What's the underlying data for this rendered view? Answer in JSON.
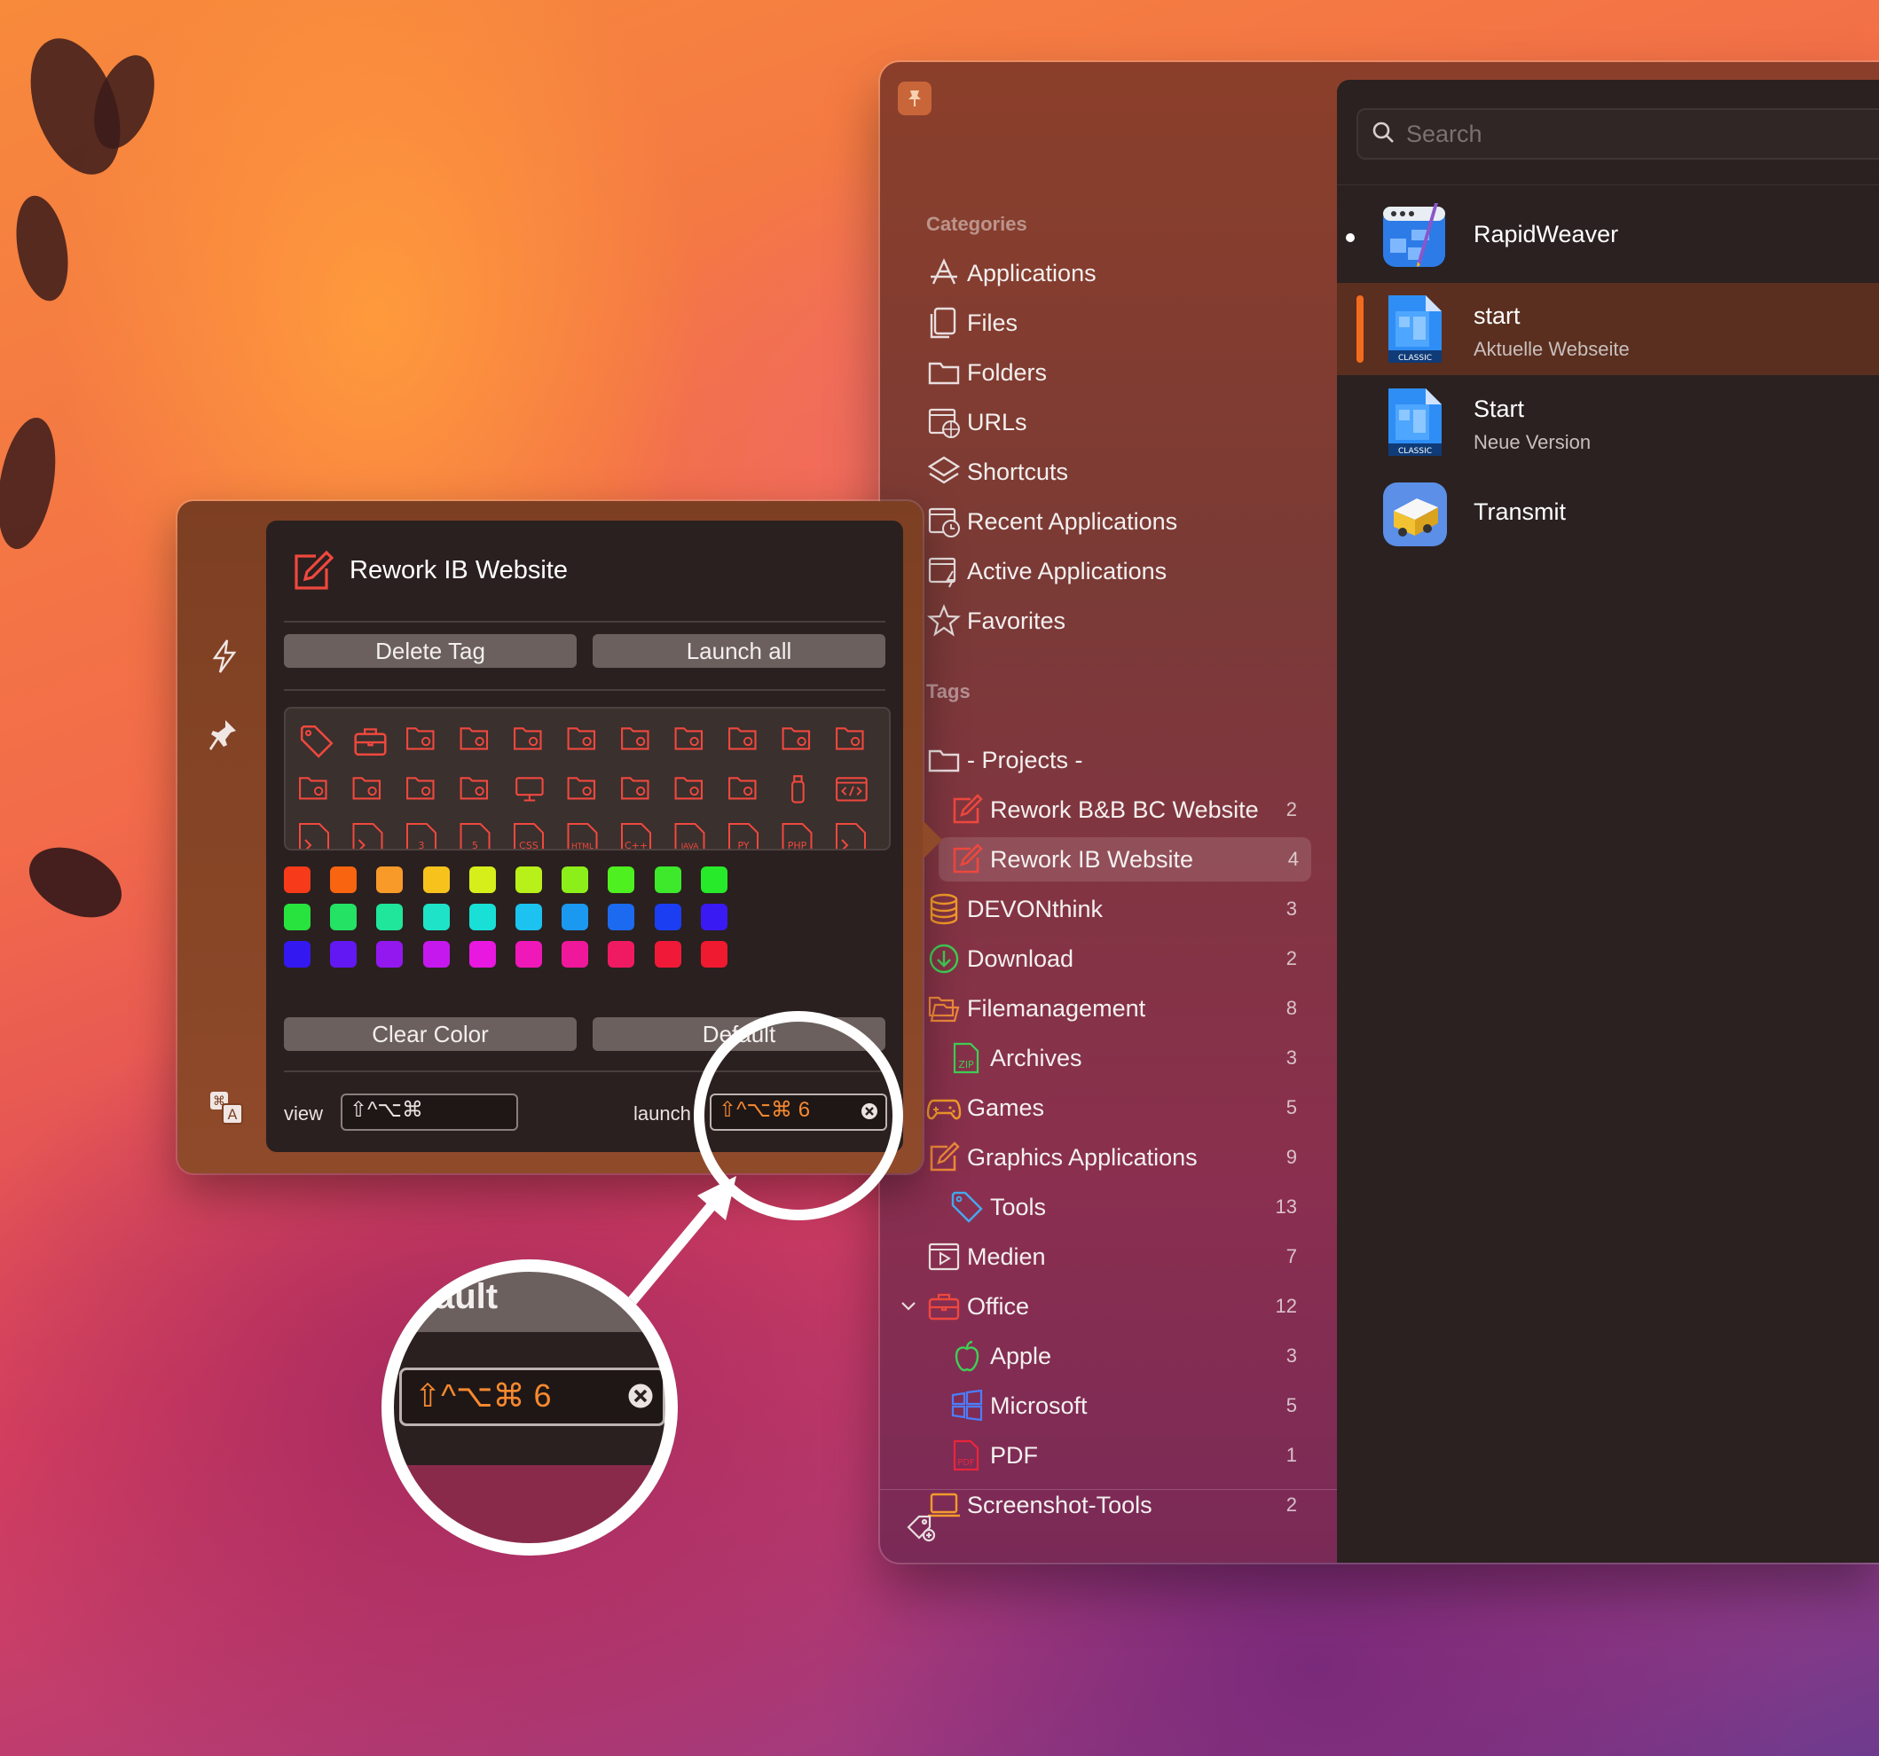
{
  "main": {
    "search_placeholder": "Search",
    "categories_header": "Categories",
    "categories": [
      {
        "label": "Applications",
        "icon": "app-store-icon"
      },
      {
        "label": "Files",
        "icon": "files-icon"
      },
      {
        "label": "Folders",
        "icon": "folder-icon"
      },
      {
        "label": "URLs",
        "icon": "globe-window-icon"
      },
      {
        "label": "Shortcuts",
        "icon": "shortcuts-icon"
      },
      {
        "label": "Recent Applications",
        "icon": "clock-window-icon"
      },
      {
        "label": "Active Applications",
        "icon": "bolt-window-icon"
      },
      {
        "label": "Favorites",
        "icon": "star-icon"
      }
    ],
    "tags_header": "Tags",
    "tags": [
      {
        "label": "- Projects -",
        "count": "",
        "icon": "folder-icon",
        "color": "#e8dede"
      },
      {
        "label": "Rework B&B BC Website",
        "count": "2",
        "icon": "edit-tag-icon",
        "color": "#f0483e"
      },
      {
        "label": "Rework IB Website",
        "count": "4",
        "icon": "edit-tag-icon",
        "color": "#f0483e"
      },
      {
        "label": "DEVONthink",
        "count": "3",
        "icon": "database-icon",
        "color": "#f39b2a"
      },
      {
        "label": "Download",
        "count": "2",
        "icon": "download-icon",
        "color": "#3fcf55"
      },
      {
        "label": "Filemanagement",
        "count": "8",
        "icon": "folders-icon",
        "color": "#f08a3a"
      },
      {
        "label": "Archives",
        "count": "3",
        "icon": "zip-icon",
        "color": "#3fcf55"
      },
      {
        "label": "Games",
        "count": "5",
        "icon": "gamepad-icon",
        "color": "#f39b2a"
      },
      {
        "label": "Graphics Applications",
        "count": "9",
        "icon": "edit-tag-icon",
        "color": "#f08a3a"
      },
      {
        "label": "Tools",
        "count": "13",
        "icon": "tag-icon",
        "color": "#45a9f0"
      },
      {
        "label": "Medien",
        "count": "7",
        "icon": "play-window-icon",
        "color": "#e8dede"
      },
      {
        "label": "Office",
        "count": "12",
        "icon": "briefcase-icon",
        "color": "#f0483e"
      },
      {
        "label": "Apple",
        "count": "3",
        "icon": "apple-icon",
        "color": "#3fcf55"
      },
      {
        "label": "Microsoft",
        "count": "5",
        "icon": "windows-icon",
        "color": "#4c7dff"
      },
      {
        "label": "PDF",
        "count": "1",
        "icon": "pdf-icon",
        "color": "#e8263b"
      },
      {
        "label": "Screenshot-Tools",
        "count": "2",
        "icon": "laptop-icon",
        "color": "#f39b2a"
      }
    ],
    "items": [
      {
        "name": "RapidWeaver",
        "sub": "",
        "icon": "rapidweaver-icon",
        "running": true
      },
      {
        "name": "start",
        "sub": "Aktuelle Webseite",
        "icon": "rapidweaver-doc-icon",
        "badge": "CLASSIC"
      },
      {
        "name": "Start",
        "sub": "Neue Version",
        "icon": "rapidweaver-doc-icon",
        "badge": "CLASSIC"
      },
      {
        "name": "Transmit",
        "sub": "",
        "icon": "transmit-icon"
      }
    ]
  },
  "popover": {
    "title": "Rework IB Website",
    "delete_label": "Delete Tag",
    "launch_all_label": "Launch all",
    "clear_color_label": "Clear Color",
    "default_label": "Default",
    "view_label": "view",
    "view_keys": "⇧^⌥⌘",
    "launch_label": "launch",
    "launch_keys": "⇧^⌥⌘ 6",
    "accent": "#f0483e",
    "colors": [
      "#f73a19",
      "#f8640f",
      "#f89a2a",
      "#f8c21d",
      "#d6ee1a",
      "#b8f01a",
      "#8cef1a",
      "#4ef01f",
      "#3ee82a",
      "#27ea2a",
      "#28e23d",
      "#23e264",
      "#1fe69a",
      "#1ee3c8",
      "#19e0d6",
      "#1cc2f0",
      "#1b98f0",
      "#1b6af0",
      "#1c3ef2",
      "#3a1af2",
      "#3318f2",
      "#6218f2",
      "#9318f0",
      "#c518ef",
      "#e818e0",
      "#ef18b8",
      "#f0189a",
      "#f01a62",
      "#f01a38",
      "#ef1a2f"
    ],
    "icon_names": [
      "tag-icon",
      "briefcase-icon",
      "folder-docs-icon",
      "folder-home-icon",
      "folder-image-icon",
      "folder-heart-icon",
      "folder-edit-icon",
      "folder-sync-icon",
      "folder-refresh-icon",
      "folder-warning-icon",
      "folder-dollar-icon",
      "folder-code-icon",
      "folder-lock-icon",
      "folder-archive-icon",
      "folder-network-icon",
      "folder-monitor-icon",
      "folder-play-icon",
      "folder-music-icon",
      "folder-download-icon",
      "folder-list-icon",
      "usb-stick-icon",
      "code-window-icon"
    ],
    "file_badges": [
      "",
      "",
      "3",
      "5",
      "CSS",
      "HTML",
      "C++",
      "JAVA",
      "PY",
      "PHP",
      ""
    ],
    "zoom_keys": "⇧^⌥⌘ 6",
    "zoom_default": "ault"
  }
}
